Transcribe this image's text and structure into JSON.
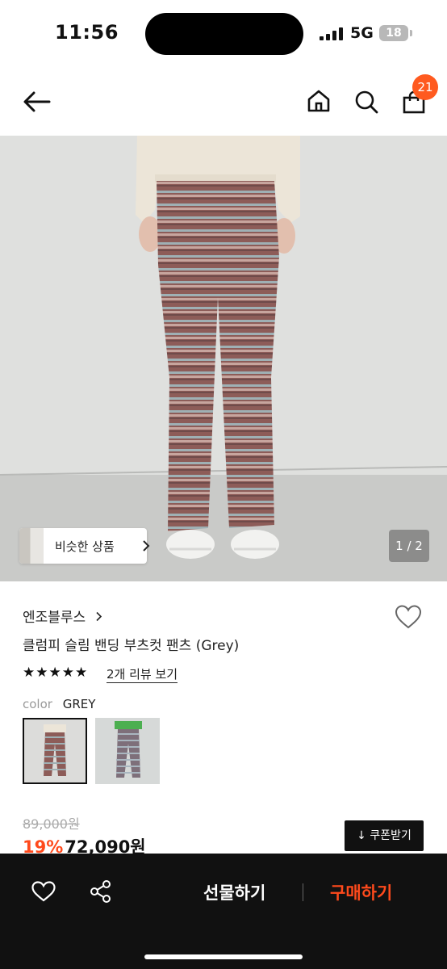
{
  "status_bar": {
    "time": "11:56",
    "network": "5G",
    "battery": "18"
  },
  "nav": {
    "cart_count": "21",
    "icons": [
      "back-arrow-icon",
      "home-icon",
      "search-icon",
      "shopping-bag-icon"
    ]
  },
  "hero": {
    "similar_label": "비슷한 상품",
    "page_indicator": "1 / 2"
  },
  "product": {
    "brand": "엔조블루스",
    "title": "클럼피 슬림 밴딩 부츠컷 팬츠 (Grey)",
    "stars": "★★★★★",
    "rating": 5,
    "review_link": "2개 리뷰 보기",
    "color_label": "color",
    "color_value": "GREY",
    "original_price": "89,000원",
    "discount": "19%",
    "price": "72,090원",
    "coupon_label": "↓ 쿠폰받기"
  },
  "bottom_bar": {
    "gift_label": "선물하기",
    "buy_label": "구매하기"
  },
  "colors": {
    "accent": "#ff4a1c",
    "badge": "#ff5a1f",
    "bar": "#111111"
  }
}
